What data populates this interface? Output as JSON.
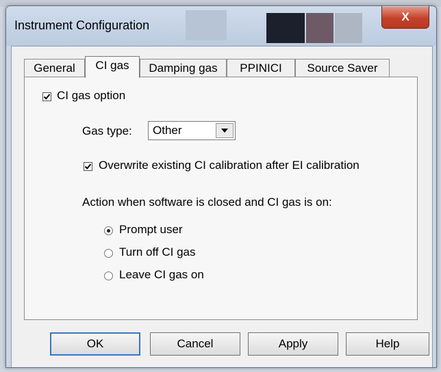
{
  "window": {
    "title": "Instrument Configuration",
    "close_glyph": "X"
  },
  "tabs": [
    {
      "label": "General",
      "active": false
    },
    {
      "label": "CI gas",
      "active": true
    },
    {
      "label": "Damping gas",
      "active": false
    },
    {
      "label": "PPINICI",
      "active": false
    },
    {
      "label": "Source Saver",
      "active": false
    }
  ],
  "ci_gas": {
    "option_label": "CI gas option",
    "option_checked": true,
    "gas_type_label": "Gas type:",
    "gas_type_value": "Other",
    "overwrite_label": "Overwrite existing CI calibration after EI calibration",
    "overwrite_checked": true,
    "action_label": "Action when software is closed and CI gas is on:",
    "radios": [
      {
        "label": "Prompt user",
        "selected": true
      },
      {
        "label": "Turn off CI gas",
        "selected": false
      },
      {
        "label": "Leave CI gas on",
        "selected": false
      }
    ]
  },
  "buttons": {
    "ok": "OK",
    "cancel": "Cancel",
    "apply": "Apply",
    "help": "Help"
  },
  "icons": {
    "close": "close-icon",
    "dropdown": "chevron-down-icon",
    "check": "checkmark-icon"
  }
}
